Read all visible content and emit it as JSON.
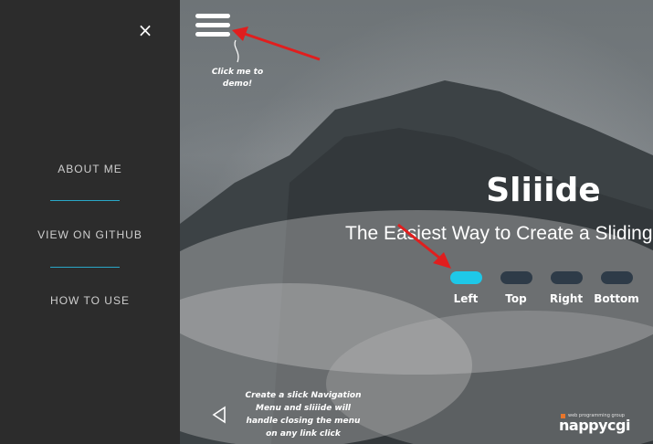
{
  "sidebar": {
    "close_icon": "×",
    "items": [
      {
        "label": "ABOUT ME"
      },
      {
        "label": "VIEW ON GITHUB"
      },
      {
        "label": "HOW TO USE"
      }
    ],
    "accent_color": "#2aa7c7"
  },
  "hero": {
    "hint_top": "Click me to demo!",
    "title": "Sliiide",
    "subtitle": "The Easiest Way to Create a Sliding I",
    "positions": [
      {
        "label": "Left",
        "active": true
      },
      {
        "label": "Top",
        "active": false
      },
      {
        "label": "Right",
        "active": false
      },
      {
        "label": "Bottom",
        "active": false
      }
    ],
    "active_color": "#1ec8e8",
    "inactive_color": "#2e3b48",
    "bottom_note": "Create a slick Navigation Menu and sliiide will handle closing the menu on any link click"
  },
  "logo": {
    "tagline": "web programming group",
    "name": "nappycgi"
  }
}
